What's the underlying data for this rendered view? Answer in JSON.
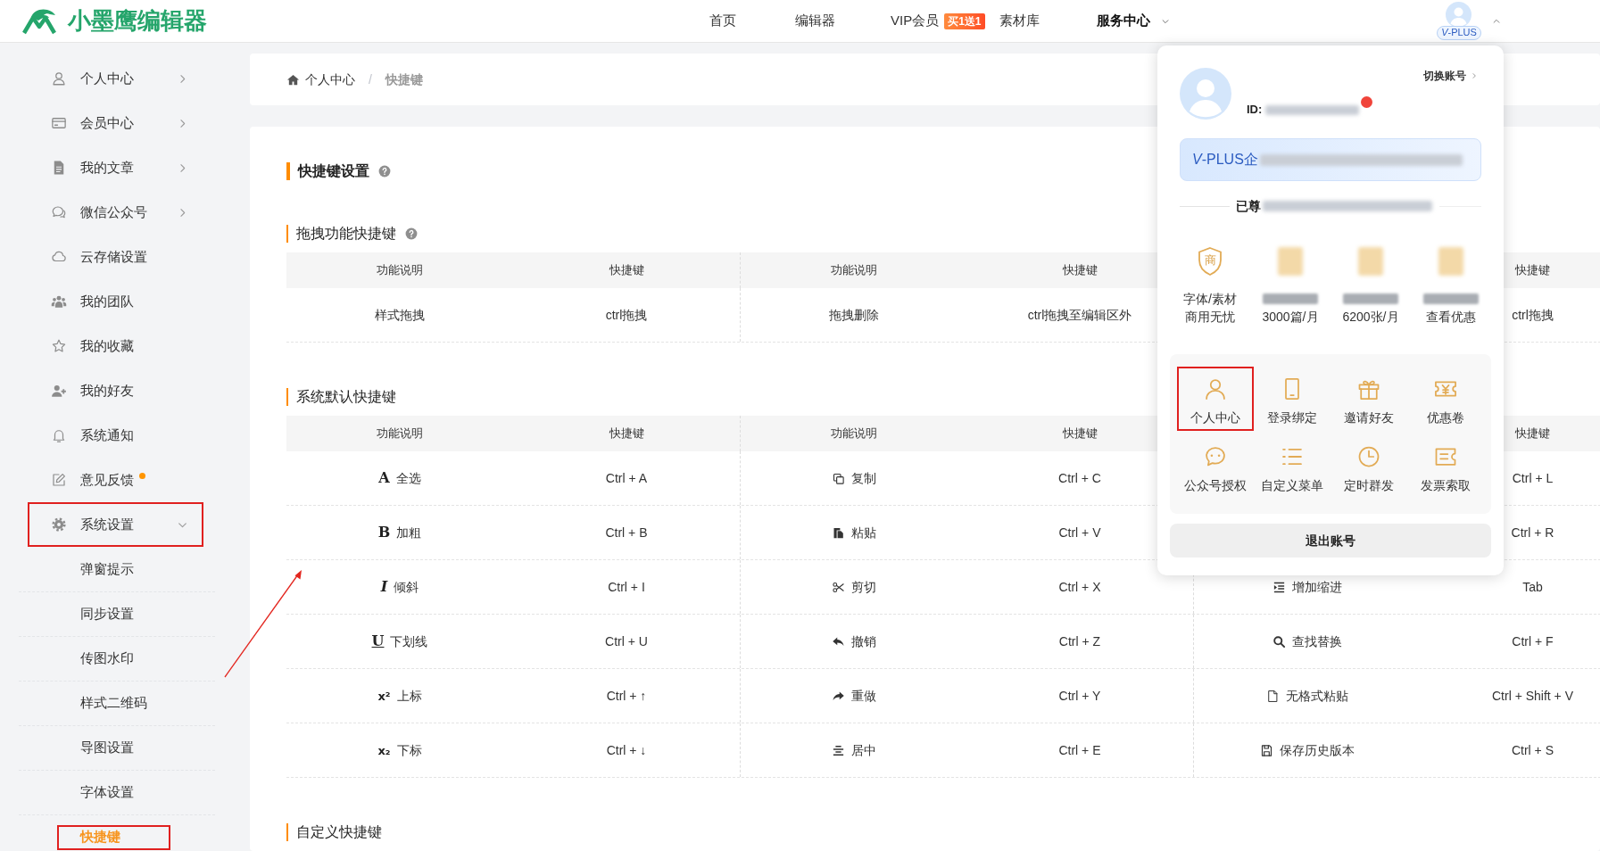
{
  "header": {
    "logo": "小墨鹰编辑器",
    "nav": [
      {
        "label": "首页",
        "selected": false
      },
      {
        "label": "编辑器",
        "selected": false
      },
      {
        "label": "VIP会员",
        "selected": false,
        "badge": "买1送1"
      },
      {
        "label": "素材库",
        "selected": false
      },
      {
        "label": "服务中心",
        "selected": true,
        "has_menu": true
      }
    ],
    "user": {
      "badge": "*V*-PLUS",
      "menu_open": true
    }
  },
  "sidebar": {
    "items": [
      {
        "label": "个人中心",
        "kind": "group",
        "expanded": false
      },
      {
        "label": "会员中心",
        "kind": "group",
        "expanded": false
      },
      {
        "label": "我的文章",
        "kind": "group",
        "expanded": false
      },
      {
        "label": "微信公众号",
        "kind": "group",
        "expanded": false
      },
      {
        "label": "云存储设置",
        "kind": "link"
      },
      {
        "label": "我的团队",
        "kind": "link"
      },
      {
        "label": "我的收藏",
        "kind": "link"
      },
      {
        "label": "我的好友",
        "kind": "link"
      },
      {
        "label": "系统通知",
        "kind": "link"
      },
      {
        "label": "意见反馈",
        "kind": "link",
        "dot": true
      },
      {
        "label": "系统设置",
        "kind": "group",
        "expanded": true,
        "highlighted": true,
        "children": [
          {
            "label": "弹窗提示",
            "selected": false
          },
          {
            "label": "同步设置",
            "selected": false
          },
          {
            "label": "传图水印",
            "selected": false
          },
          {
            "label": "样式二维码",
            "selected": false
          },
          {
            "label": "导图设置",
            "selected": false
          },
          {
            "label": "字体设置",
            "selected": false
          },
          {
            "label": "快捷键",
            "selected": true,
            "highlighted": true
          }
        ]
      }
    ]
  },
  "breadcrumb": {
    "items": [
      {
        "label": "个人中心",
        "current": false
      },
      {
        "label": "快捷键",
        "current": true
      }
    ],
    "separator": "/"
  },
  "content": {
    "title": "快捷键设置",
    "help": true,
    "sections": [
      {
        "title": "拖拽功能快捷键",
        "help": true,
        "table": {
          "header_groups": [
            {
              "description": "功能说明",
              "shortcut": "快捷键"
            },
            {
              "description": "功能说明",
              "shortcut": "快捷键"
            },
            {
              "shortcut": "快捷键"
            }
          ],
          "rows": [
            [
              {
                "label": "样式拖拽",
                "shortcut": "ctrl拖拽"
              },
              {
                "label": "拖拽删除",
                "shortcut": "ctrl拖拽至编辑区外"
              },
              {
                "shortcut": "ctrl拖拽"
              }
            ]
          ]
        }
      },
      {
        "title": "系统默认快捷键",
        "table": {
          "header_groups": [
            {
              "description": "功能说明",
              "shortcut": "快捷键"
            },
            {
              "description": "功能说明",
              "shortcut": "快捷键"
            },
            {
              "shortcut": "快捷键"
            }
          ],
          "rows": [
            [
              {
                "glyph": "A",
                "label": "全选",
                "shortcut": "Ctrl + A"
              },
              {
                "label": "复制",
                "shortcut": "Ctrl + C"
              },
              {
                "shortcut": "Ctrl + L"
              }
            ],
            [
              {
                "glyph": "B",
                "label": "加粗",
                "shortcut": "Ctrl + B"
              },
              {
                "label": "粘贴",
                "shortcut": "Ctrl + V"
              },
              {
                "shortcut": "Ctrl + R"
              }
            ],
            [
              {
                "glyph": "I",
                "label": "倾斜",
                "shortcut": "Ctrl + I"
              },
              {
                "label": "剪切",
                "shortcut": "Ctrl + X"
              },
              {
                "label": "增加缩进",
                "shortcut": "Tab"
              }
            ],
            [
              {
                "glyph": "U",
                "label": "下划线",
                "shortcut": "Ctrl + U"
              },
              {
                "label": "撤销",
                "shortcut": "Ctrl + Z"
              },
              {
                "label": "查找替换",
                "shortcut": "Ctrl + F"
              }
            ],
            [
              {
                "glyph": "x²",
                "label": "上标",
                "shortcut": "Ctrl + ↑"
              },
              {
                "label": "重做",
                "shortcut": "Ctrl + Y"
              },
              {
                "label": "无格式粘贴",
                "shortcut": "Ctrl + Shift + V"
              }
            ],
            [
              {
                "glyph": "x₂",
                "label": "下标",
                "shortcut": "Ctrl + ↓"
              },
              {
                "label": "居中",
                "shortcut": "Ctrl + E"
              },
              {
                "label": "保存历史版本",
                "shortcut": "Ctrl + S"
              }
            ]
          ]
        }
      },
      {
        "title": "自定义快捷键"
      }
    ]
  },
  "account_menu": {
    "switch_account": "切换账号",
    "id_label": "ID:",
    "id_blurred": true,
    "notification_dot": true,
    "plan": {
      "text": "*V*-PLUS企",
      "blurred": true
    },
    "tenure": {
      "text": "已尊",
      "blurred": true
    },
    "benefits": [
      {
        "icon_text": "商",
        "title": "字体/素材",
        "subtitle": "商用无忧"
      },
      {
        "icon_blurred": true,
        "title_blurred": true,
        "subtitle": "3000篇/月"
      },
      {
        "icon_blurred": true,
        "title_blurred": true,
        "subtitle": "6200张/月"
      },
      {
        "icon_blurred": true,
        "title_blurred": true,
        "subtitle": "查看优惠"
      }
    ],
    "menu": [
      {
        "label": "个人中心",
        "highlighted": true
      },
      {
        "label": "登录绑定"
      },
      {
        "label": "邀请好友"
      },
      {
        "label": "优惠卷"
      },
      {
        "label": "公众号授权"
      },
      {
        "label": "自定义菜单"
      },
      {
        "label": "定时群发"
      },
      {
        "label": "发票索取"
      }
    ],
    "logout": "退出账号"
  },
  "annotation": {
    "kind": "arrow"
  }
}
